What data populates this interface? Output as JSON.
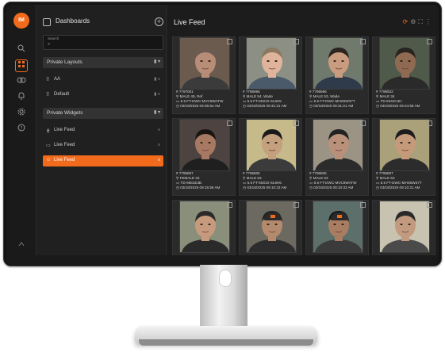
{
  "user": {
    "initials": "IM"
  },
  "rail": [
    "search-icon",
    "dashboards-icon",
    "watch-icon",
    "alerts-icon",
    "settings-icon",
    "help-icon"
  ],
  "sidebar": {
    "title": "Dashboards",
    "search": {
      "label": "Search",
      "placeholder": ""
    },
    "private_layouts": {
      "label": "Private Layouts",
      "items": [
        {
          "label": "AA"
        },
        {
          "label": "Default"
        }
      ]
    },
    "private_widgets": {
      "label": "Private Widgets",
      "items": [
        {
          "label": "Live Feed"
        },
        {
          "label": "Live Feed"
        },
        {
          "label": "Live Feed"
        }
      ]
    }
  },
  "feed": {
    "title": "Live Feed",
    "tiles": [
      {
        "id": "7797001",
        "person": "MALE 45, Ref",
        "camera": "6.5 FT-DWC-MVC8WATW",
        "time": "03/18/2025 09:35:54 AM"
      },
      {
        "id": "7796965",
        "person": "MALE 54, Wade",
        "camera": "5.5 FT-M3CD-SL9H5",
        "time": "03/18/2025 09:31:21 AM"
      },
      {
        "id": "7796966",
        "person": "MALE 53, Wade",
        "camera": "6.5 FT-DWC-MHS5W37T",
        "time": "03/18/2025 09:31:21 AM"
      },
      {
        "id": "7796922",
        "person": "MALE 34",
        "camera": "TD-9442C3H",
        "time": "03/18/2025 09:24:59 AM"
      },
      {
        "id": "7796857",
        "person": "FEMALE 33",
        "camera": "TD-9581E3B",
        "time": "03/18/2025 09:15:58 AM"
      },
      {
        "id": "7796806",
        "person": "MALE 53",
        "camera": "5.5 FT-M3CD-SL9H5",
        "time": "03/18/2025 09:10:33 AM"
      },
      {
        "id": "7796805",
        "person": "MALE 53",
        "camera": "6.5 FT-DWC-MVC8WATW",
        "time": "03/18/2025 09:10:33 AM"
      },
      {
        "id": "7796807",
        "person": "MALE 53",
        "camera": "6.5 FT-DWC-MHS5W37T",
        "time": "03/18/2025 09:10:31 AM"
      },
      {
        "id": "",
        "person": "",
        "camera": "",
        "time": ""
      },
      {
        "id": "",
        "person": "",
        "camera": "",
        "time": ""
      },
      {
        "id": "",
        "person": "",
        "camera": "",
        "time": ""
      },
      {
        "id": "",
        "person": "",
        "camera": "",
        "time": ""
      }
    ]
  },
  "colors": {
    "accent": "#f26a1b",
    "background": "#1e1e1e",
    "panel": "#202020"
  }
}
